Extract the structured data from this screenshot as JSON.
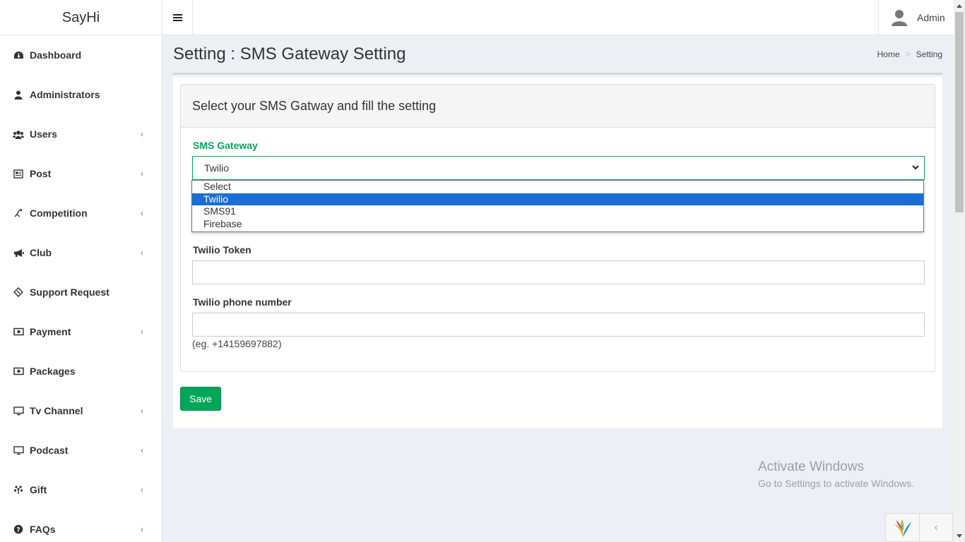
{
  "header": {
    "brand": "SayHi",
    "toggle_icon": "hamburger-icon",
    "user_name": "Admin"
  },
  "sidebar": {
    "items": [
      {
        "label": "Dashboard",
        "icon": "dashboard-icon",
        "has_children": false
      },
      {
        "label": "Administrators",
        "icon": "user-icon",
        "has_children": false
      },
      {
        "label": "Users",
        "icon": "users-icon",
        "has_children": true
      },
      {
        "label": "Post",
        "icon": "newspaper-icon",
        "has_children": true
      },
      {
        "label": "Competition",
        "icon": "competition-icon",
        "has_children": true
      },
      {
        "label": "Club",
        "icon": "bullhorn-icon",
        "has_children": true
      },
      {
        "label": "Support Request",
        "icon": "ticket-icon",
        "has_children": false
      },
      {
        "label": "Payment",
        "icon": "money-icon",
        "has_children": true
      },
      {
        "label": "Packages",
        "icon": "money-icon",
        "has_children": false
      },
      {
        "label": "Tv Channel",
        "icon": "monitor-icon",
        "has_children": true
      },
      {
        "label": "Podcast",
        "icon": "monitor-icon",
        "has_children": true
      },
      {
        "label": "Gift",
        "icon": "gift-icon",
        "has_children": true
      },
      {
        "label": "FAQs",
        "icon": "question-icon",
        "has_children": true
      }
    ]
  },
  "page": {
    "title": "Setting : SMS Gateway Setting",
    "breadcrumb": [
      "Home",
      "Setting"
    ],
    "card_title": "Select your SMS Gatway and fill the setting",
    "gateway": {
      "label": "SMS Gateway",
      "selected": "Twilio",
      "options": [
        "Select",
        "Twilio",
        "SMS91",
        "Firebase"
      ],
      "highlighted": "Twilio"
    },
    "twilio_token": {
      "label": "Twilio Token",
      "value": ""
    },
    "twilio_phone": {
      "label": "Twilio phone number",
      "value": "",
      "help": "(eg. +14159697882)"
    },
    "save_label": "Save"
  },
  "watermark": {
    "line1": "Activate Windows",
    "line2": "Go to Settings to activate Windows."
  },
  "colors": {
    "accent": "#00a65a",
    "selection": "#1a6dd6",
    "background": "#ecf0f5"
  }
}
